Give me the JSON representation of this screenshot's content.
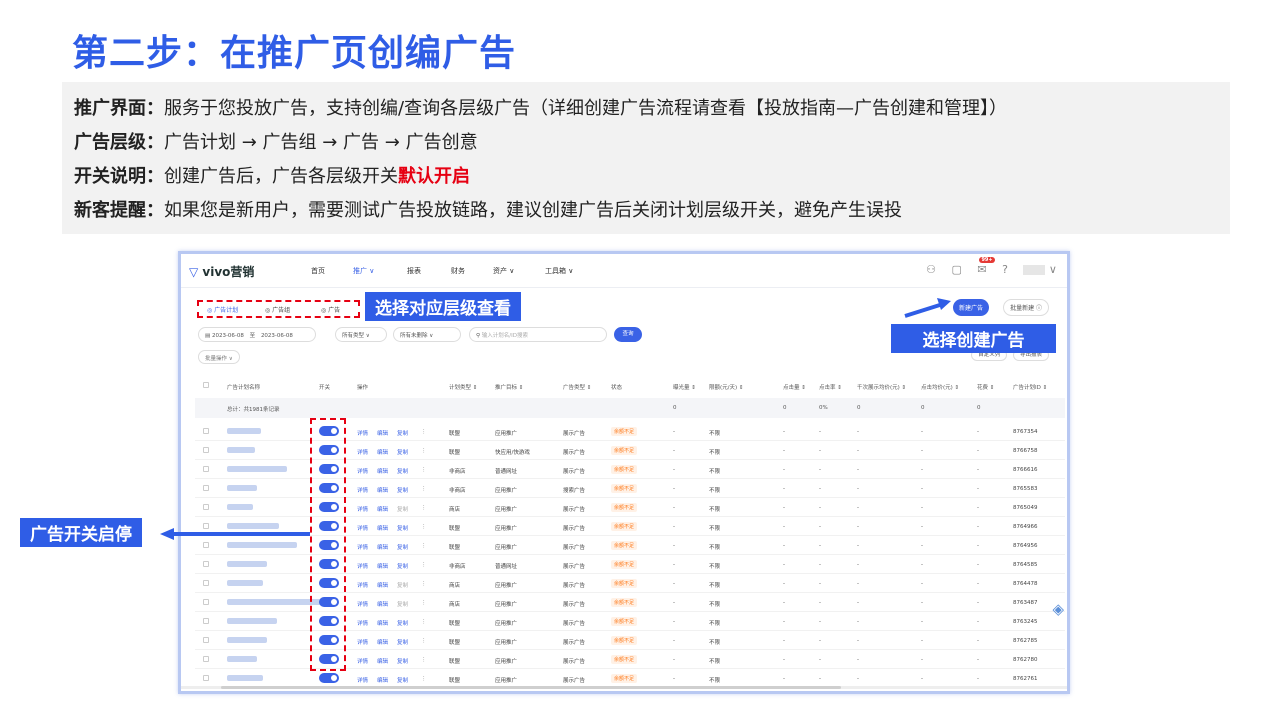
{
  "slide": {
    "title": "第二步：在推广页创编广告",
    "lines": [
      {
        "key": "推广界面：",
        "text": "服务于您投放广告，支持创编/查询各层级广告（详细创建广告流程请查看【投放指南—广告创建和管理】）"
      },
      {
        "key": "广告层级：",
        "text": "广告计划 → 广告组 → 广告 → 广告创意"
      },
      {
        "key": "开关说明：",
        "text": "创建广告后，广告各层级开关",
        "highlight": "默认开启"
      },
      {
        "key": "新客提醒：",
        "text": "如果您是新用户，需要测试广告投放链路，建议创建广告后关闭计划层级开关，避免产生误投"
      }
    ],
    "callouts": {
      "level": "选择对应层级查看",
      "create": "选择创建广告",
      "switch": "广告开关启停"
    }
  },
  "app": {
    "logo": "vivo营销",
    "nav": [
      "首页",
      "推广 ∨",
      "报表",
      "财务",
      "资产 ∨",
      "工具箱 ∨"
    ],
    "nav_badge": "99+",
    "icons": [
      "people-icon",
      "doc-icon",
      "mail-icon",
      "help-icon"
    ],
    "tabs": [
      "广告计划",
      "广告组",
      "广告"
    ],
    "btn_new": "新建广告",
    "btn_batch": "批量新建 ⓘ",
    "date_start": "2023-06-08",
    "date_sep": "至",
    "date_end": "2023-06-08",
    "filter_type": "所有类型 ∨",
    "filter_status": "所有未删除 ∨",
    "search_placeholder": "输入计划名/ID搜索",
    "query": "查询",
    "batch_op": "批量操作 ∨",
    "custom_cols": "自定义列",
    "export": "导出报表",
    "table": {
      "headers": [
        "广告计划名称",
        "开关",
        "操作",
        "计划类型 ⇕",
        "推广目标 ⇕",
        "广告类型 ⇕",
        "状态",
        "曝光量 ⇕",
        "限额(元/天) ⇕",
        "点击量 ⇕",
        "点击率 ⇕",
        "千次展示均价(元) ⇕",
        "点击均价(元) ⇕",
        "花费 ⇕",
        "广告计划ID ⇕"
      ],
      "total": {
        "label": "总计：共1981条记录",
        "exposure": "0",
        "clicks": "0",
        "ctr": "0%",
        "cpm": "0",
        "cpc": "0",
        "cost": "0"
      },
      "ops": [
        "详情",
        "编辑",
        "复制"
      ],
      "status": "余额不足",
      "rows": [
        {
          "plan_type": "联盟",
          "goal": "应用推广",
          "ad_type": "展示广告",
          "limit": "不限",
          "id": "8767354",
          "copy_disabled": false
        },
        {
          "plan_type": "联盟",
          "goal": "快应用/快游戏",
          "ad_type": "展示广告",
          "limit": "不限",
          "id": "8766758",
          "copy_disabled": false
        },
        {
          "plan_type": "非商店",
          "goal": "普通网址",
          "ad_type": "展示广告",
          "limit": "不限",
          "id": "8766616",
          "copy_disabled": false
        },
        {
          "plan_type": "非商店",
          "goal": "应用推广",
          "ad_type": "搜索广告",
          "limit": "不限",
          "id": "8765583",
          "copy_disabled": false
        },
        {
          "plan_type": "商店",
          "goal": "应用推广",
          "ad_type": "展示广告",
          "limit": "不限",
          "id": "8765049",
          "copy_disabled": true
        },
        {
          "plan_type": "联盟",
          "goal": "应用推广",
          "ad_type": "展示广告",
          "limit": "不限",
          "id": "8764966",
          "copy_disabled": false
        },
        {
          "plan_type": "联盟",
          "goal": "应用推广",
          "ad_type": "展示广告",
          "limit": "不限",
          "id": "8764956",
          "copy_disabled": false
        },
        {
          "plan_type": "非商店",
          "goal": "普通网址",
          "ad_type": "展示广告",
          "limit": "不限",
          "id": "8764585",
          "copy_disabled": false
        },
        {
          "plan_type": "商店",
          "goal": "应用推广",
          "ad_type": "展示广告",
          "limit": "不限",
          "id": "8764478",
          "copy_disabled": true
        },
        {
          "plan_type": "商店",
          "goal": "应用推广",
          "ad_type": "展示广告",
          "limit": "不限",
          "id": "8763487",
          "copy_disabled": true
        },
        {
          "plan_type": "联盟",
          "goal": "应用推广",
          "ad_type": "展示广告",
          "limit": "不限",
          "id": "8763245",
          "copy_disabled": false
        },
        {
          "plan_type": "联盟",
          "goal": "应用推广",
          "ad_type": "展示广告",
          "limit": "不限",
          "id": "8762785",
          "copy_disabled": false
        },
        {
          "plan_type": "联盟",
          "goal": "应用推广",
          "ad_type": "展示广告",
          "limit": "不限",
          "id": "8762780",
          "copy_disabled": false
        },
        {
          "plan_type": "联盟",
          "goal": "应用推广",
          "ad_type": "展示广告",
          "limit": "不限",
          "id": "8762761",
          "copy_disabled": false
        }
      ]
    }
  },
  "colors": {
    "accent": "#2f5de6",
    "red": "#e60012",
    "status_orange": "#ff7a1a"
  }
}
